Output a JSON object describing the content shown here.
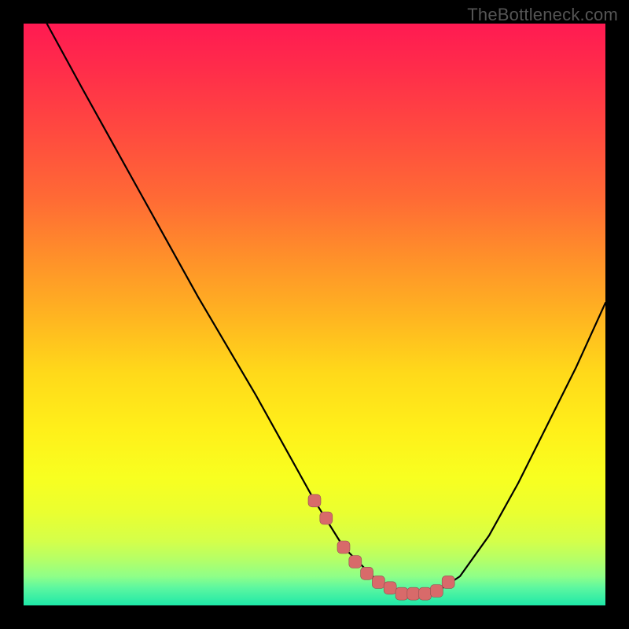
{
  "attribution": "TheBottleneck.com",
  "colors": {
    "black": "#000000",
    "attribution_text": "#555555",
    "curve": "#000000",
    "marker_fill": "#d86a6a",
    "marker_stroke": "#905050",
    "gradient_top": "#ff1a52",
    "gradient_mid": "#ffd91a",
    "gradient_bottom": "#1ee8a8"
  },
  "chart_data": {
    "type": "line",
    "title": "",
    "xlabel": "",
    "ylabel": "",
    "xlim": [
      0,
      100
    ],
    "ylim": [
      0,
      100
    ],
    "grid": false,
    "legend": false,
    "series": [
      {
        "name": "bottleneck-curve",
        "x": [
          4,
          10,
          20,
          30,
          40,
          45,
          50,
          55,
          60,
          63,
          65,
          70,
          72,
          75,
          80,
          85,
          90,
          95,
          100
        ],
        "y": [
          100,
          89,
          71,
          53,
          36,
          27,
          18,
          10,
          5,
          3,
          2,
          2,
          3,
          5,
          12,
          21,
          31,
          41,
          52
        ]
      }
    ],
    "markers": {
      "name": "highlighted-region",
      "x": [
        50,
        52,
        55,
        57,
        59,
        61,
        63,
        65,
        67,
        69,
        71,
        73
      ],
      "y": [
        18,
        15,
        10,
        7.5,
        5.5,
        4,
        3,
        2,
        2,
        2,
        2.5,
        4
      ]
    }
  }
}
